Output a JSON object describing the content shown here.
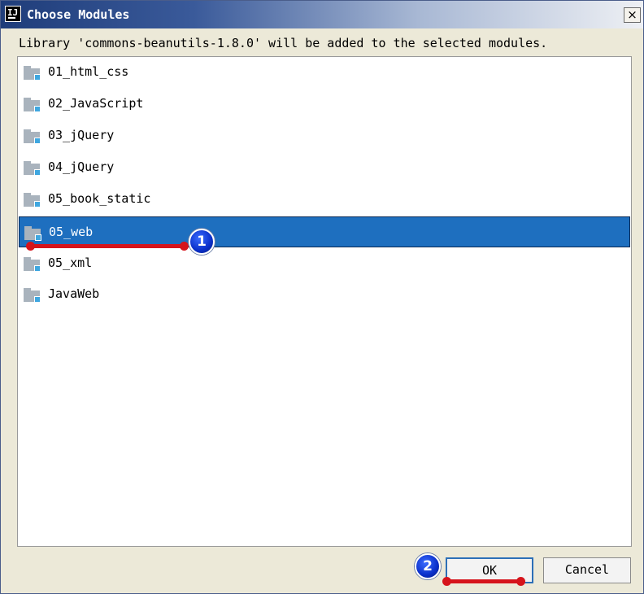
{
  "window": {
    "title": "Choose Modules",
    "close_glyph": "×",
    "app_icon_glyph": "IJ"
  },
  "message": "Library 'commons-beanutils-1.8.0' will be added to the selected modules.",
  "modules": [
    {
      "label": "01_html_css",
      "icon": "module-folder-icon",
      "selected": false
    },
    {
      "label": "02_JavaScript",
      "icon": "module-folder-icon",
      "selected": false
    },
    {
      "label": "03_jQuery",
      "icon": "module-folder-icon",
      "selected": false
    },
    {
      "label": "04_jQuery",
      "icon": "module-folder-icon",
      "selected": false
    },
    {
      "label": "05_book_static",
      "icon": "module-folder-icon",
      "selected": false
    },
    {
      "label": "05_web",
      "icon": "module-folder-icon",
      "selected": true
    },
    {
      "label": "05_xml",
      "icon": "module-folder-icon",
      "selected": false
    },
    {
      "label": "JavaWeb",
      "icon": "module-folder-icon",
      "selected": false
    }
  ],
  "buttons": {
    "ok": "OK",
    "cancel": "Cancel"
  },
  "annotations": [
    {
      "number": "1"
    },
    {
      "number": "2"
    }
  ],
  "colors": {
    "selection": "#1e6fbf",
    "annotation_line": "#d6141b",
    "annotation_marker": "#0a2fc9"
  }
}
